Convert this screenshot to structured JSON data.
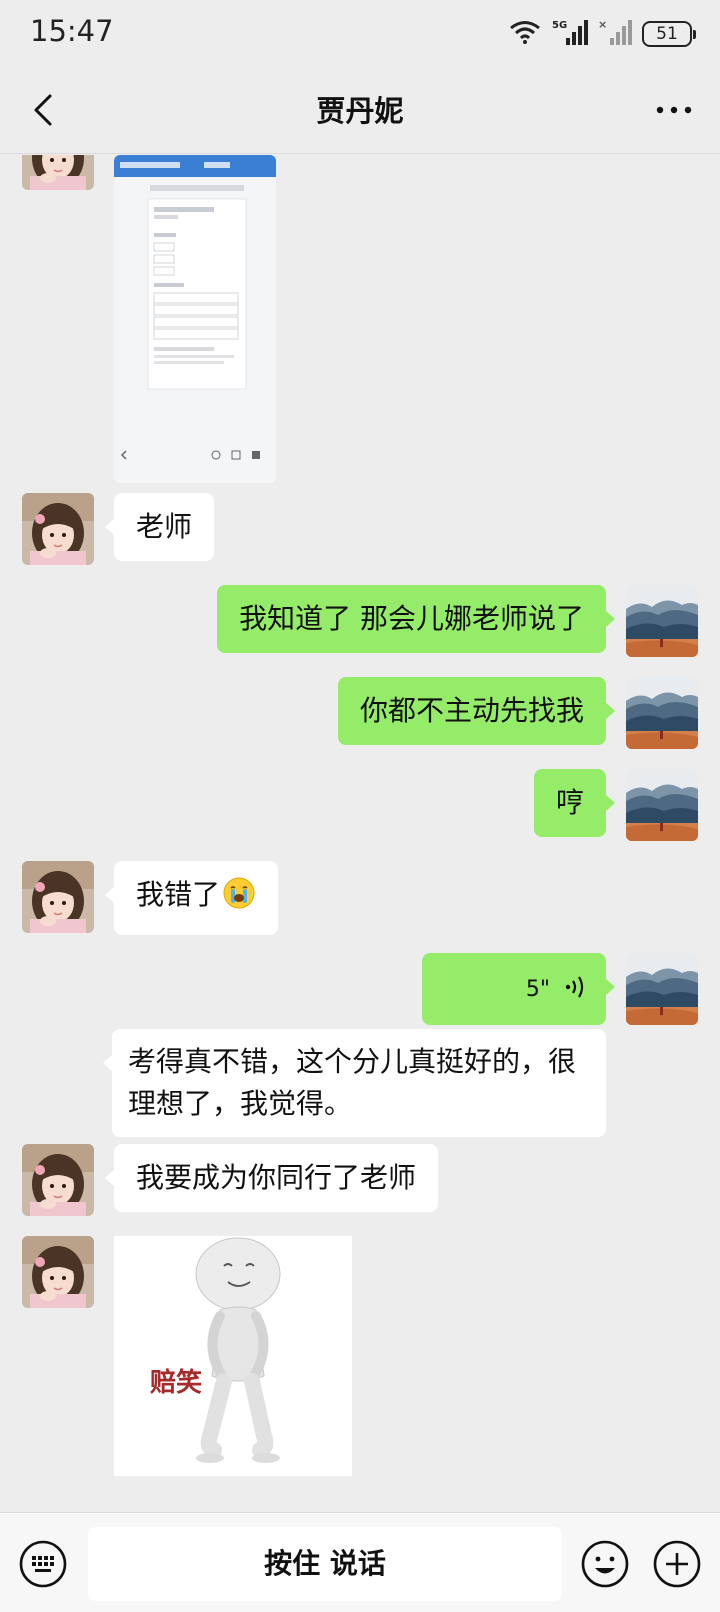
{
  "status": {
    "time": "15:47",
    "network": "5G",
    "battery": "51"
  },
  "header": {
    "title": "贾丹妮"
  },
  "messages": [
    {
      "type": "image",
      "side": "in",
      "content": "shared-webpage-screenshot"
    },
    {
      "type": "text",
      "side": "in",
      "text": "老师"
    },
    {
      "type": "text",
      "side": "out",
      "text": "我知道了 那会儿娜老师说了"
    },
    {
      "type": "text",
      "side": "out",
      "text": "你都不主动先找我"
    },
    {
      "type": "text",
      "side": "out",
      "text": "哼"
    },
    {
      "type": "text",
      "side": "in",
      "text": "我错了",
      "emoji": "crying-face"
    },
    {
      "type": "voice",
      "side": "out",
      "duration": "5\""
    },
    {
      "type": "text",
      "side": "in",
      "text": "考得真不错，这个分儿真挺好的，很理想了，我觉得。"
    },
    {
      "type": "text",
      "side": "in",
      "text": "我要成为你同行了老师"
    },
    {
      "type": "sticker",
      "side": "in",
      "caption": "赔笑"
    }
  ],
  "input": {
    "hold_to_talk": "按住 说话"
  },
  "icons": {
    "back": "chevron-left-icon",
    "more": "more-icon",
    "keyboard": "keyboard-icon",
    "emoji": "emoji-icon",
    "plus": "plus-icon",
    "voice": "voice-wave-icon"
  },
  "colors": {
    "outgoing_bubble": "#95ec69",
    "incoming_bubble": "#ffffff",
    "background": "#ededed"
  }
}
